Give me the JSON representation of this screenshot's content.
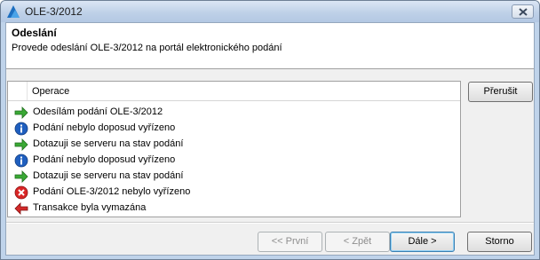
{
  "window": {
    "title": "OLE-3/2012"
  },
  "header": {
    "title": "Odeslání",
    "subtitle": "Provede odeslání OLE-3/2012 na portál elektronického podání"
  },
  "list": {
    "column": "Operace",
    "rows": [
      {
        "icon": "green-arrow-right-icon",
        "text": "Odesílám podání OLE-3/2012"
      },
      {
        "icon": "info-icon",
        "text": "Podání nebylo doposud vyřízeno"
      },
      {
        "icon": "green-arrow-right-icon",
        "text": "Dotazuji se serveru na stav podání"
      },
      {
        "icon": "info-icon",
        "text": "Podání nebylo doposud vyřízeno"
      },
      {
        "icon": "green-arrow-right-icon",
        "text": "Dotazuji se serveru na stav podání"
      },
      {
        "icon": "error-icon",
        "text": "Podání OLE-3/2012 nebylo vyřízeno"
      },
      {
        "icon": "red-arrow-left-icon",
        "text": "Transakce byla vymazána"
      }
    ]
  },
  "buttons": {
    "abort": "Přerušit",
    "first": "<< První",
    "back": "< Zpět",
    "next": "Dále >",
    "cancel": "Storno"
  }
}
